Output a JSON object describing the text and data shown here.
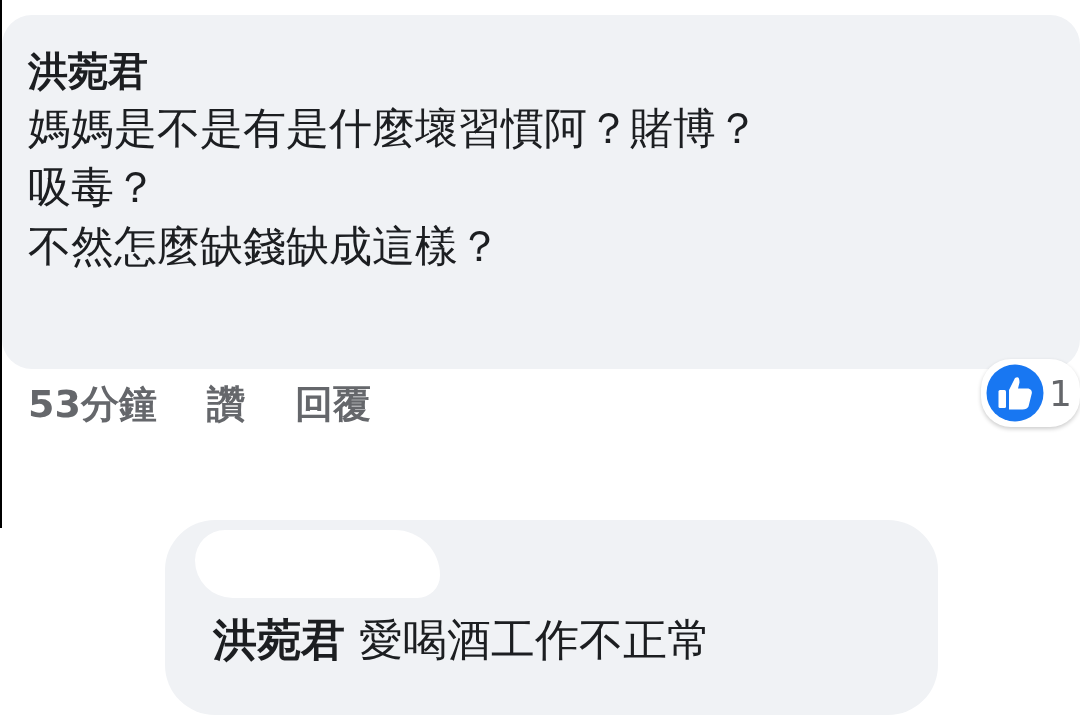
{
  "comment": {
    "author": "洪菀君",
    "lines": [
      "媽媽是不是有是什麼壞習慣阿？賭博？",
      "吸毒？",
      "不然怎麼缺錢缺成這樣？"
    ],
    "time": "53分鐘",
    "actions": [
      "讚",
      "回覆"
    ],
    "reaction_count": "1"
  },
  "reply": {
    "mention": "洪菀君",
    "text": "愛喝酒工作不正常"
  }
}
